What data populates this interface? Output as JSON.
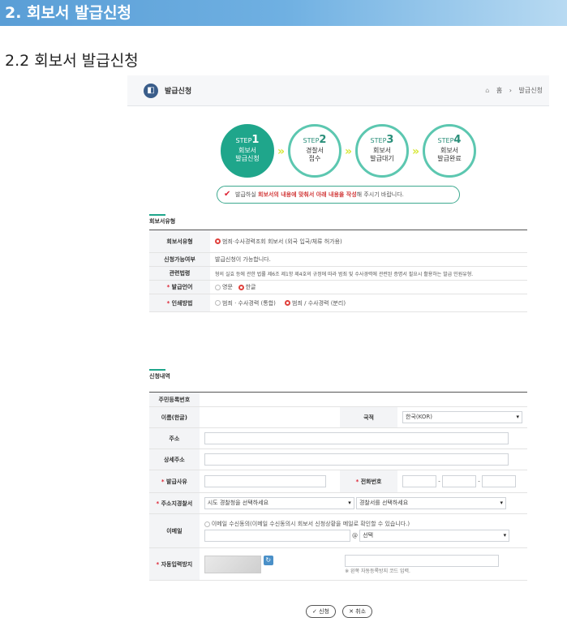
{
  "banner": "2. 회보서 발급신청",
  "subtitle": "2.2 회보서 발급신청",
  "topbar": {
    "title": "발급신청",
    "home": "홈",
    "sep": "›",
    "current": "발급신청"
  },
  "steps": [
    {
      "num": "STEP",
      "n": "1",
      "label1": "회보서",
      "label2": "발급신청"
    },
    {
      "num": "STEP",
      "n": "2",
      "label1": "경찰서",
      "label2": "접수"
    },
    {
      "num": "STEP",
      "n": "3",
      "label1": "회보서",
      "label2": "발급대기"
    },
    {
      "num": "STEP",
      "n": "4",
      "label1": "회보서",
      "label2": "발급완료"
    }
  ],
  "notice": {
    "pre": "발급하실 ",
    "highlight": "회보서의 내용에 맞춰서 아래 내용을 작성",
    "post": "해 주시기 바랍니다."
  },
  "group1": {
    "title": "회보서유형",
    "rows": {
      "type_label": "회보서유형",
      "type_value": "범죄·수사경력조회 회보서 (외국 입국/체류 허가용)",
      "avail_label": "신청가능여부",
      "avail_value": "발급신청이 가능합니다.",
      "law_label": "관련법령",
      "law_value": "형의 실효 등에 관한 법률 제6조 제1항 제4호의 규정에 따라 범죄 및 수사경력에 관련된 증명서 필요시 활용하는 발급 민원유형.",
      "lang_label": "발급언어",
      "lang_opt1": "영문",
      "lang_opt2": "한글",
      "print_label": "인쇄방법",
      "print_opt1": "범죄 · 수사경력 (통합)",
      "print_opt2": "범죄 / 수사경력 (분리)"
    }
  },
  "group2": {
    "title": "신청내역",
    "rrn_label": "주민등록번호",
    "name_label": "이름(한글)",
    "nation_label": "국적",
    "nation_value": "한국(KOR)",
    "addr_label": "주소",
    "addr2_label": "상세주소",
    "reason_label": "발급사유",
    "phone_label": "전화번호",
    "dash": "-",
    "police_label": "주소지경찰서",
    "police_sel1": "시도 경찰청을 선택하세요",
    "police_sel2": "경찰서를 선택하세요",
    "email_label": "이메일",
    "email_consent": "이메일 수신동의(이메일 수신동의시 회보서 신청상황을 메일로 확인할 수 있습니다.)",
    "email_at": "@",
    "email_domain": "선택",
    "captcha_label": "자동입력방지",
    "captcha_hint": "※ 왼쪽 자동등록방지 코드 입력."
  },
  "buttons": {
    "submit": "✓ 신청",
    "cancel": "✕ 취소"
  }
}
